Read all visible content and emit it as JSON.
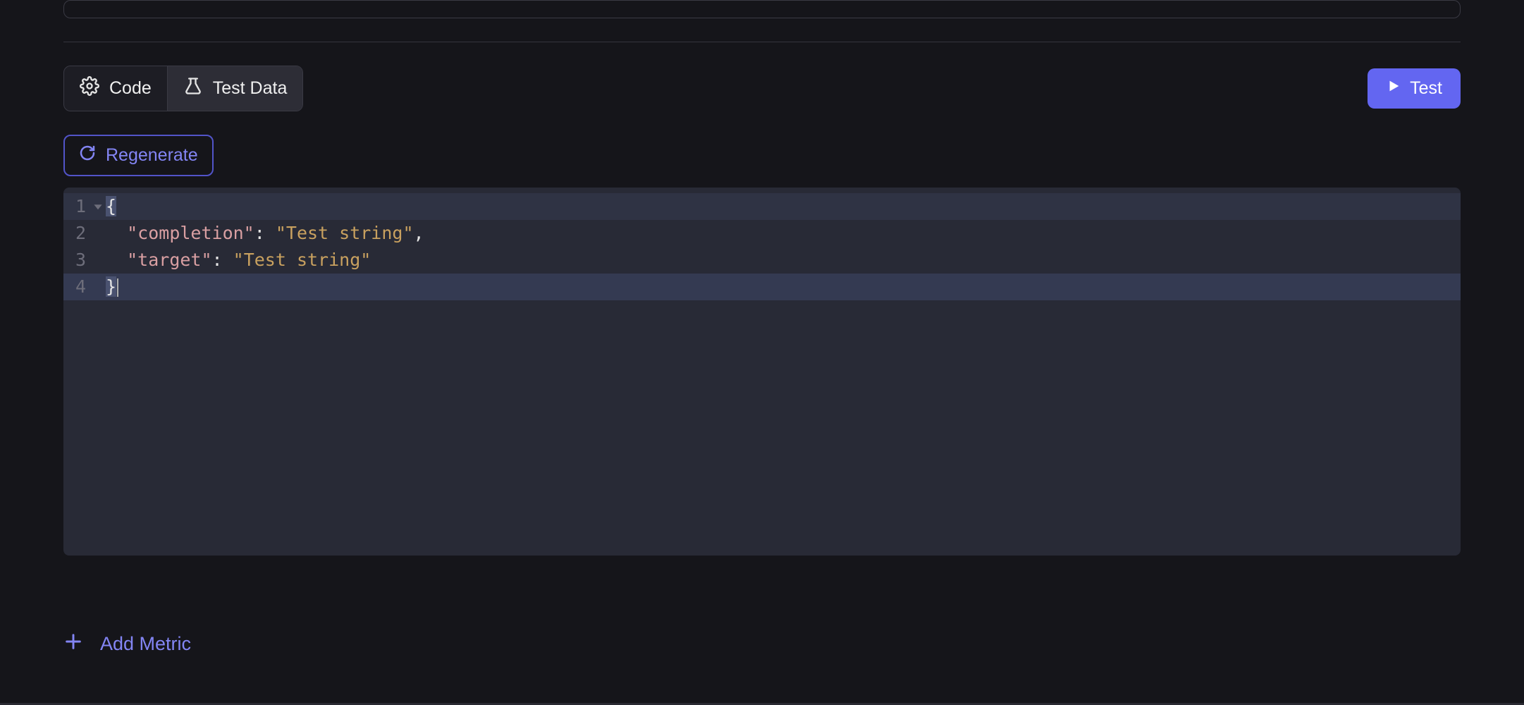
{
  "tabs": {
    "code_label": "Code",
    "test_data_label": "Test Data"
  },
  "buttons": {
    "test_label": "Test",
    "regenerate_label": "Regenerate",
    "add_metric_label": "Add Metric"
  },
  "editor": {
    "lines": [
      {
        "num": "1",
        "open_brace": "{"
      },
      {
        "num": "2",
        "key": "\"completion\"",
        "colon": ": ",
        "value": "\"Test string\"",
        "comma": ","
      },
      {
        "num": "3",
        "key": "\"target\"",
        "colon": ": ",
        "value": "\"Test string\""
      },
      {
        "num": "4",
        "close_brace": "}"
      }
    ]
  }
}
